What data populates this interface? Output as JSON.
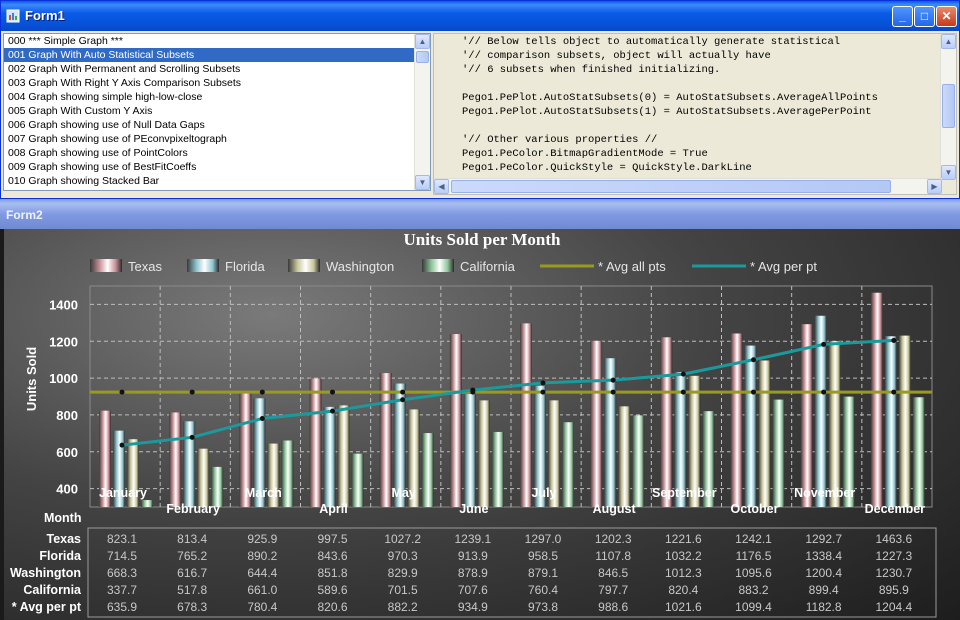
{
  "form1": {
    "title": "Form1",
    "list_items": [
      "000 *** Simple Graph ***",
      "001 Graph With Auto Statistical Subsets",
      "002 Graph With Permanent and Scrolling Subsets",
      "003 Graph With Right Y Axis Comparison Subsets",
      "004 Graph showing simple high-low-close",
      "005 Graph With Custom Y Axis",
      "006 Graph showing use of Null Data Gaps",
      "007 Graph showing use of PEconvpixeltograph",
      "008 Graph showing use of PointColors",
      "009 Graph showing use of BestFitCoeffs",
      "010 Graph showing Stacked Bar"
    ],
    "selected_index": 1,
    "code_lines": [
      "'// Below tells object to automatically generate statistical",
      "'// comparison subsets, object will actually have",
      "'// 6 subsets when finished initializing.",
      "",
      "Pego1.PePlot.AutoStatSubsets(0) = AutoStatSubsets.AverageAllPoints",
      "Pego1.PePlot.AutoStatSubsets(1) = AutoStatSubsets.AveragePerPoint",
      "",
      "'// Other various properties //",
      "Pego1.PeColor.BitmapGradientMode = True",
      "Pego1.PeColor.QuickStyle = QuickStyle.DarkLine"
    ]
  },
  "form2": {
    "title": "Form2"
  },
  "colors": {
    "texas": "#c98f96",
    "florida": "#8fc6d0",
    "washington": "#c9c79a",
    "california": "#8ec79a",
    "avg_all": "#9a9a20",
    "avg_per": "#1a9a9c"
  },
  "chart_data": {
    "type": "bar",
    "title": "Units Sold per Month",
    "xlabel": "Month",
    "ylabel": "Units Sold",
    "ylim": [
      300,
      1500
    ],
    "yticks": [
      400,
      600,
      800,
      1000,
      1200,
      1400
    ],
    "grid": true,
    "legend_position": "top",
    "categories": [
      "January",
      "February",
      "March",
      "April",
      "May",
      "June",
      "July",
      "August",
      "September",
      "October",
      "November",
      "December"
    ],
    "series": [
      {
        "name": "Texas",
        "values": [
          823.1,
          813.4,
          925.9,
          997.5,
          1027.2,
          1239.1,
          1297.0,
          1202.3,
          1221.6,
          1242.1,
          1292.7,
          1463.6
        ]
      },
      {
        "name": "Florida",
        "values": [
          714.5,
          765.2,
          890.2,
          843.6,
          970.3,
          913.9,
          958.5,
          1107.8,
          1032.2,
          1176.5,
          1338.4,
          1227.3
        ]
      },
      {
        "name": "Washington",
        "values": [
          668.3,
          616.7,
          644.4,
          851.8,
          829.9,
          878.9,
          879.1,
          846.5,
          1012.3,
          1095.6,
          1200.4,
          1230.7
        ]
      },
      {
        "name": "California",
        "values": [
          337.7,
          517.8,
          661.0,
          589.6,
          701.5,
          707.6,
          760.4,
          797.7,
          820.4,
          883.2,
          899.4,
          895.9
        ]
      }
    ],
    "line_series": [
      {
        "name": "* Avg all pts",
        "constant": 924.0
      },
      {
        "name": "* Avg per pt",
        "values": [
          635.9,
          678.3,
          780.4,
          820.6,
          882.2,
          934.9,
          973.8,
          988.6,
          1021.6,
          1099.4,
          1182.8,
          1204.4
        ]
      }
    ],
    "table_rows": [
      {
        "label": "Texas",
        "values": [
          "823.1",
          "813.4",
          "925.9",
          "997.5",
          "1027.2",
          "1239.1",
          "1297.0",
          "1202.3",
          "1221.6",
          "1242.1",
          "1292.7",
          "1463.6"
        ]
      },
      {
        "label": "Florida",
        "values": [
          "714.5",
          "765.2",
          "890.2",
          "843.6",
          "970.3",
          "913.9",
          "958.5",
          "1107.8",
          "1032.2",
          "1176.5",
          "1338.4",
          "1227.3"
        ]
      },
      {
        "label": "Washington",
        "values": [
          "668.3",
          "616.7",
          "644.4",
          "851.8",
          "829.9",
          "878.9",
          "879.1",
          "846.5",
          "1012.3",
          "1095.6",
          "1200.4",
          "1230.7"
        ]
      },
      {
        "label": "California",
        "values": [
          "337.7",
          "517.8",
          "661.0",
          "589.6",
          "701.5",
          "707.6",
          "760.4",
          "797.7",
          "820.4",
          "883.2",
          "899.4",
          "895.9"
        ]
      },
      {
        "label": "* Avg per pt",
        "values": [
          "635.9",
          "678.3",
          "780.4",
          "820.6",
          "882.2",
          "934.9",
          "973.8",
          "988.6",
          "1021.6",
          "1099.4",
          "1182.8",
          "1204.4"
        ]
      }
    ]
  }
}
